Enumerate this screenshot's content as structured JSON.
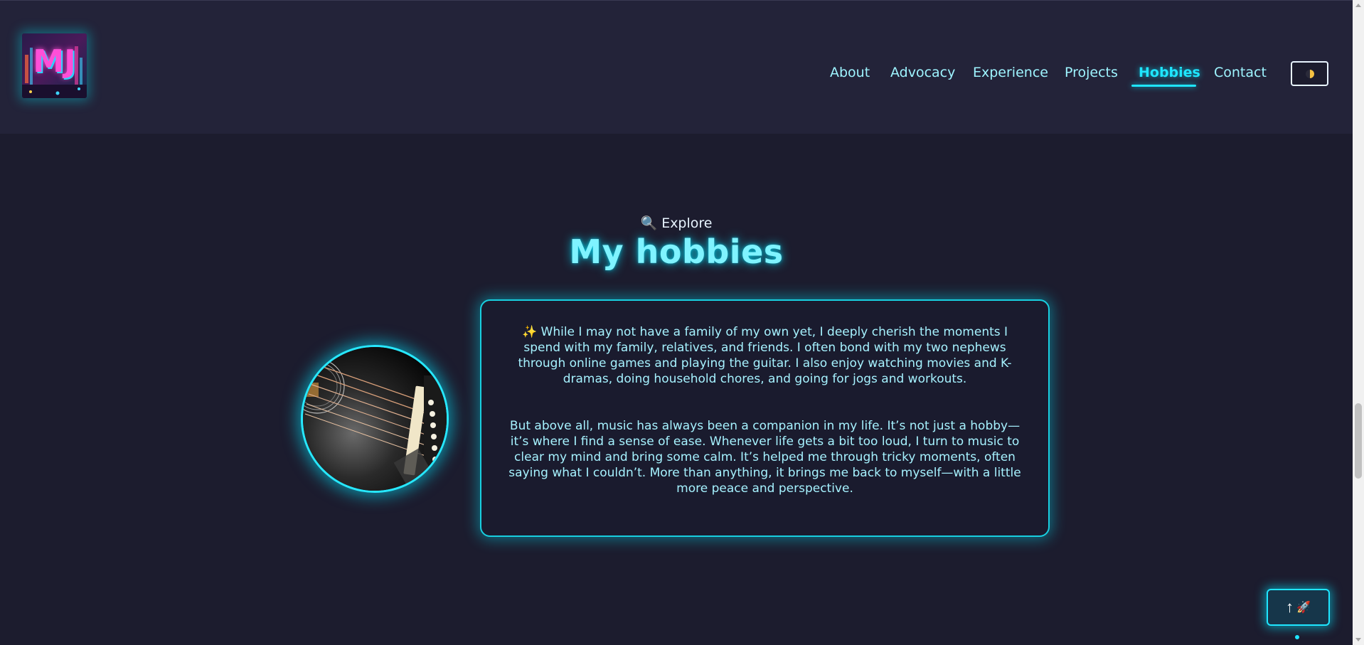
{
  "header": {
    "logo_text": "MJ",
    "nav": [
      {
        "label": "About",
        "active": false
      },
      {
        "label": "Advocacy",
        "active": false
      },
      {
        "label": "Experience",
        "active": false
      },
      {
        "label": "Projects",
        "active": false
      },
      {
        "label": "Hobbies",
        "active": true
      },
      {
        "label": "Contact",
        "active": false
      }
    ],
    "theme_toggle_icon": "half-moon-icon"
  },
  "section": {
    "eyebrow_emoji": "🔍",
    "eyebrow_label": "Explore",
    "title": "My hobbies",
    "image_subject": "guitar-icon",
    "paragraph_1_emoji": "✨",
    "paragraph_1": "While I may not have a family of my own yet, I deeply cherish the moments I spend with my family, relatives, and friends. I often bond with my two nephews through online games and playing the guitar. I also enjoy watching movies and K-dramas, doing household chores, and going for jogs and workouts.",
    "paragraph_2": "But above all, music has always been a companion in my life. It’s not just a hobby—it’s where I find a sense of ease. Whenever life gets a bit too loud, I turn to music to clear my mind and bring some calm. It’s helped me through tricky moments, often saying what I couldn’t. More than anything, it brings me back to myself—with a little more peace and perspective."
  },
  "back_to_top": {
    "arrow": "↑",
    "emoji": "🚀"
  },
  "colors": {
    "background": "#1c1c2e",
    "header": "#232339",
    "accent": "#1fe6ff",
    "text": "#a6f2ff"
  }
}
